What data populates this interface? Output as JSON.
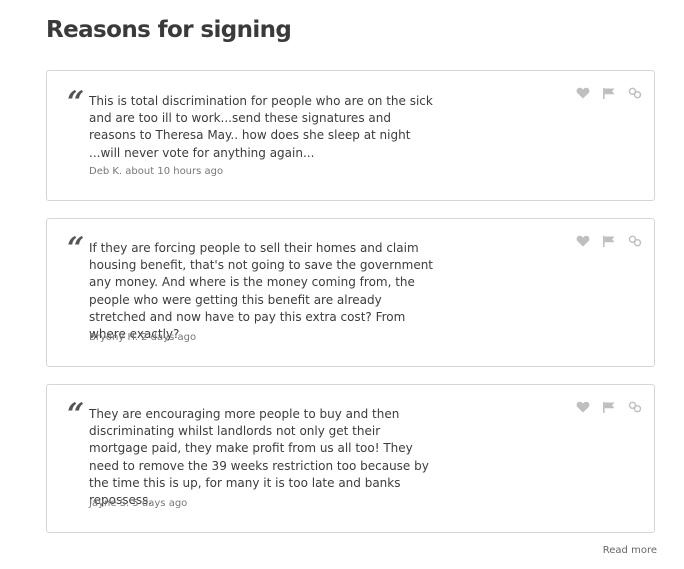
{
  "section": {
    "title": "Reasons for signing",
    "read_more_label": "Read more"
  },
  "reasons": [
    {
      "quote_glyph": "“",
      "text": "This is total discrimination for people who are on the sick and are too ill to work...send these signatures and reasons to Theresa May.. how does she sleep at night ...will never vote for anything again...",
      "meta": "Deb K. about 10 hours ago",
      "icons": [
        "heart-icon",
        "flag-icon",
        "link-icon"
      ]
    },
    {
      "quote_glyph": "“",
      "text": "If they are forcing people to sell their homes and claim housing benefit, that's not going to save the government any money. And where is the money coming from, the people who were getting this benefit are already stretched and now have to pay this extra cost? From where exactly?",
      "meta": "Bryony H. 2 days ago",
      "icons": [
        "heart-icon",
        "flag-icon",
        "link-icon"
      ]
    },
    {
      "quote_glyph": "“",
      "text": "They are encouraging more people to buy and then discriminating whilst landlords not only get their mortgage paid, they make profit from us all too! They need to remove the 39 weeks restriction too because by the time this is up, for many it is too late and banks repossess.",
      "meta": "Jayne S. 5 days ago",
      "icons": [
        "heart-icon",
        "flag-icon",
        "link-icon"
      ]
    }
  ],
  "colors": {
    "icon": "#bfbfbf",
    "card_border": "#d6d6d6",
    "text": "#3c3c3c",
    "meta": "#777777"
  }
}
